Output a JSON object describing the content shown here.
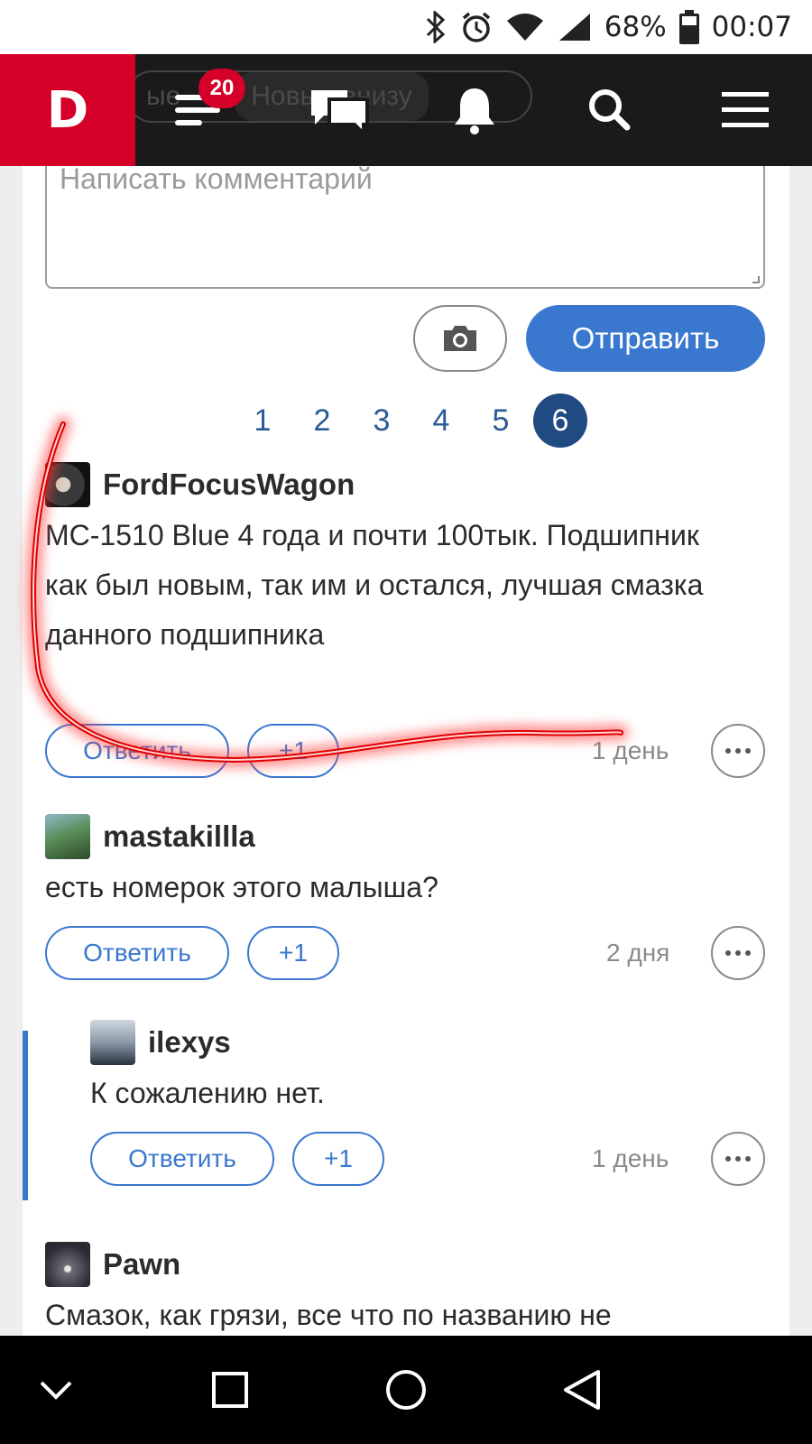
{
  "status_bar": {
    "battery": "68%",
    "time": "00:07"
  },
  "topnav": {
    "logo": "D",
    "ghost_tab_left": "ые",
    "ghost_tab_right": "Новые внизу",
    "feed_badge": "20"
  },
  "comment_form": {
    "placeholder": "Написать комментарий",
    "send_label": "Отправить"
  },
  "pagination": {
    "pages": [
      "1",
      "2",
      "3",
      "4",
      "5",
      "6"
    ],
    "active_page": "6"
  },
  "comments": [
    {
      "username": "FordFocusWagon",
      "text": "MC-1510 Blue 4 года и почти 100тык. Подшипник как был новым, так им и остался, лучшая смазка данного подшипника",
      "reply_label": "Ответить",
      "plus_label": "+1",
      "time": "1 день"
    },
    {
      "username": "mastakillla",
      "text": "есть номерок этого малыша?",
      "reply_label": "Ответить",
      "plus_label": "+1",
      "time": "2 дня"
    },
    {
      "username": "ilexys",
      "text": "К сожалению нет.",
      "reply_label": "Ответить",
      "plus_label": "+1",
      "time": "1 день"
    },
    {
      "username": "Pawn",
      "text": "Смазок, как грязи, все что по названию не"
    }
  ],
  "colors": {
    "brand_red": "#d4002a",
    "accent_blue": "#3a78d0",
    "annotation_stroke": "#ff1a1a"
  }
}
